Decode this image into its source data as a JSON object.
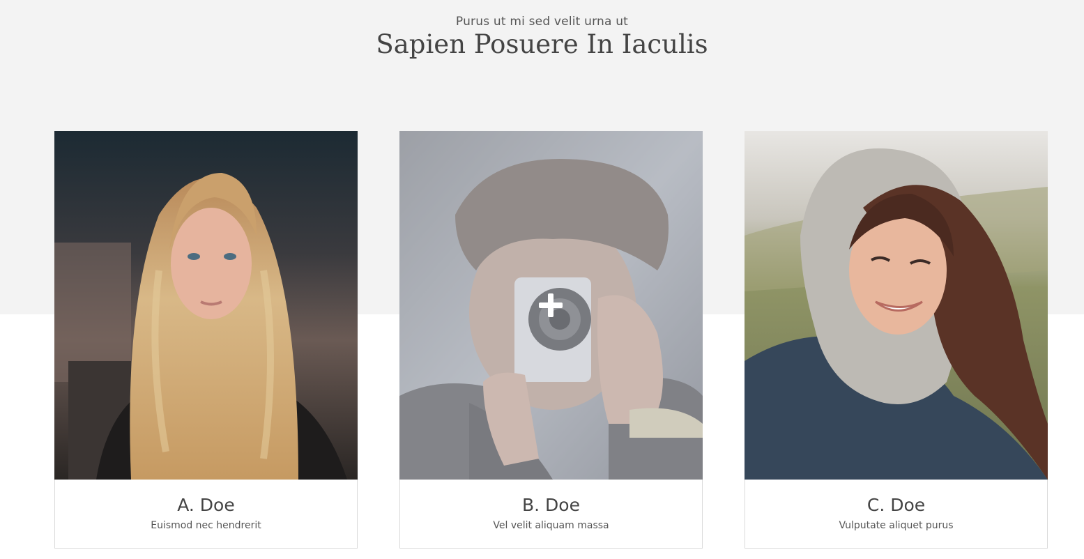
{
  "section": {
    "subtitle": "Purus ut mi sed velit urna ut",
    "title": "Sapien Posuere In Iaculis"
  },
  "team": [
    {
      "name": "A. Doe",
      "role": "Euismod nec hendrerit",
      "photo": "woman-long-blonde-hair-portrait"
    },
    {
      "name": "B. Doe",
      "role": "Vel velit aliquam massa",
      "photo": "person-with-camera-portrait",
      "hover_icon": "plus-icon"
    },
    {
      "name": "C. Doe",
      "role": "Vulputate aliquet purus",
      "photo": "smiling-woman-in-hood-portrait"
    }
  ],
  "colors": {
    "band": "#f3f3f3",
    "text": "#444444",
    "card_border": "#dadada"
  }
}
